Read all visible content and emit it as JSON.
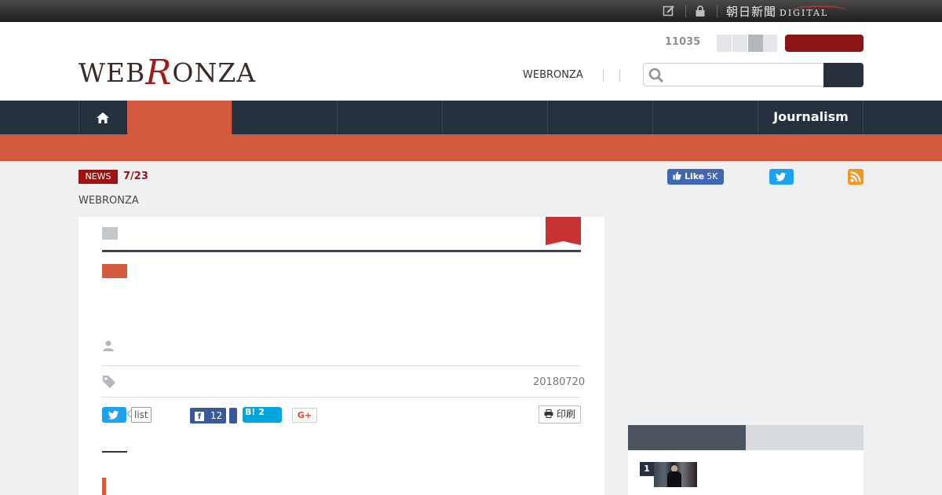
{
  "topbar": {
    "icons": [
      "edit-icon",
      "lock-icon"
    ],
    "brand": "朝日新聞",
    "brand_sub": "DIGITAL"
  },
  "header": {
    "logo_left": "WEB",
    "logo_r": "R",
    "logo_right": "ONZA",
    "count": "11035",
    "link": "WEBRONZA",
    "search": {
      "placeholder": "",
      "icon": "search-icon"
    }
  },
  "nav": {
    "home_icon": "home-icon",
    "last_item": "Journalism"
  },
  "news": {
    "badge": "NEWS",
    "date": "7/23",
    "breadcrumb": "WEBRONZA"
  },
  "social_top": {
    "fb_like": "Like",
    "fb_count": "5K",
    "icons": [
      "facebook-like-icon",
      "twitter-icon",
      "rss-icon"
    ]
  },
  "article": {
    "date": "20180720",
    "share": {
      "list_label": "list",
      "fb_count": "12",
      "hatena_label": "B!",
      "hatena_count": "2",
      "gplus_label": "G+",
      "print_label": "印刷"
    }
  },
  "sidebar": {
    "ranking": [
      {
        "rank": "1"
      }
    ]
  },
  "colors": {
    "brand_red": "#9b1313",
    "accent_orange": "#d35a3e",
    "nav_dark": "#263140",
    "twitter_blue": "#1da1f2",
    "facebook_blue": "#3b5998"
  }
}
